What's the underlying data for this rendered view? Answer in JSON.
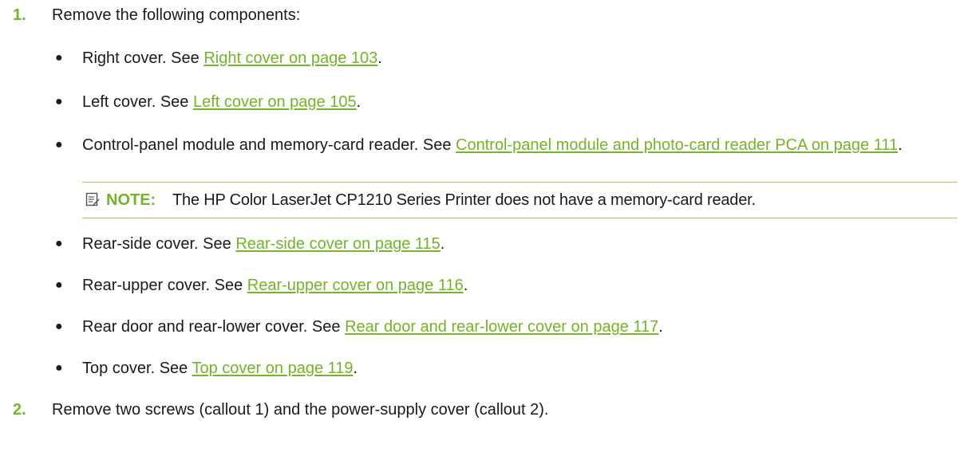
{
  "steps": [
    {
      "number": "1.",
      "text": "Remove the following components:"
    },
    {
      "number": "2.",
      "text": "Remove two screws (callout 1) and the power-supply cover (callout 2)."
    }
  ],
  "components": [
    {
      "text": "Right cover. See ",
      "link": "Right cover on page 103",
      "suffix": "."
    },
    {
      "text": "Left cover. See ",
      "link": "Left cover on page 105",
      "suffix": "."
    },
    {
      "text": "Control-panel module and memory-card reader. See ",
      "link": "Control-panel module and photo-card reader PCA on page 111",
      "suffix": "."
    },
    {
      "text": "Rear-side cover. See ",
      "link": "Rear-side cover on page 115",
      "suffix": "."
    },
    {
      "text": "Rear-upper cover. See ",
      "link": "Rear-upper cover on page 116",
      "suffix": "."
    },
    {
      "text": "Rear door and rear-lower cover. See ",
      "link": "Rear door and rear-lower cover on page 117",
      "suffix": "."
    },
    {
      "text": "Top cover. See ",
      "link": "Top cover on page 119",
      "suffix": "."
    }
  ],
  "bullet_symbol": "●",
  "note": {
    "icon": "note-icon",
    "label": "NOTE:",
    "text": "The HP Color LaserJet CP1210 Series Printer does not have a memory-card reader."
  },
  "colors": {
    "accent": "#73b527",
    "text": "#1a1a1a"
  }
}
